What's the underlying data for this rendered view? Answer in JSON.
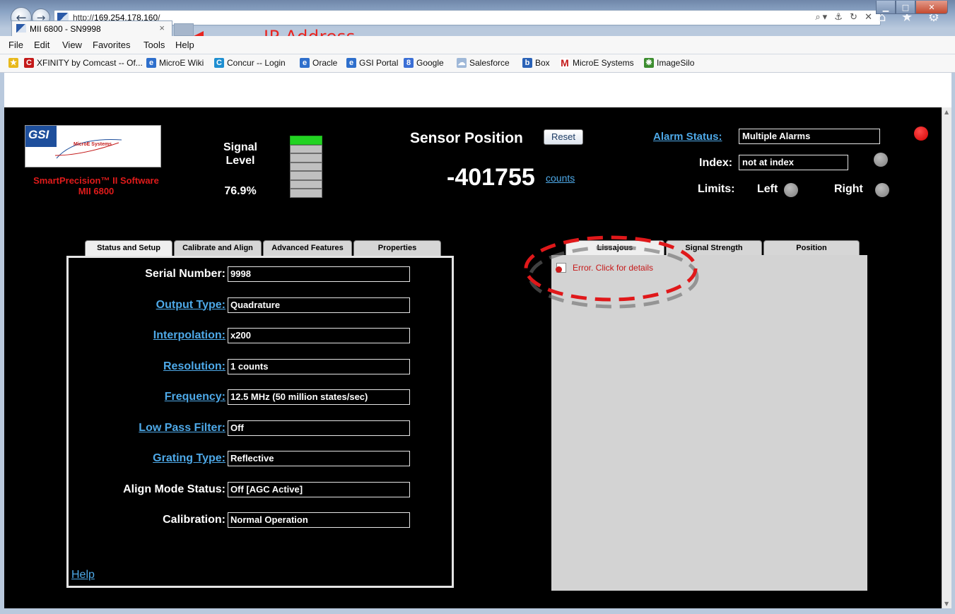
{
  "browser": {
    "url_scheme": "http://",
    "url_host": "169.254.178.160",
    "url_path": "/",
    "tab_title": "MII 6800 - SN9998",
    "tab_close": "×",
    "address_tools": "⌕▾ ⚓ ↻ ✕",
    "right_icons": "⌂ ★ ⚙",
    "menu": [
      "File",
      "Edit",
      "View",
      "Favorites",
      "Tools",
      "Help"
    ],
    "favorites": [
      {
        "label": "XFINITY by Comcast -- Of...",
        "icon": "C",
        "color": "#c41a1a"
      },
      {
        "label": "MicroE Wiki",
        "icon": "e",
        "color": "#2e6fcc"
      },
      {
        "label": "Concur -- Login",
        "icon": "C",
        "color": "#1f8fd1"
      },
      {
        "label": "Oracle",
        "icon": "e",
        "color": "#2e6fcc"
      },
      {
        "label": "GSI Portal",
        "icon": "e",
        "color": "#2e6fcc"
      },
      {
        "label": "Google",
        "icon": "8",
        "color": "#3b6fd6"
      },
      {
        "label": "Salesforce",
        "icon": "☁",
        "color": "#9fb8d8"
      },
      {
        "label": "Box",
        "icon": "b",
        "color": "#2a62b7"
      },
      {
        "label": "MicroE Systems",
        "icon": "M",
        "color": "#c41a1a"
      },
      {
        "label": "ImageSilo",
        "icon": "❋",
        "color": "#3c8d2f"
      }
    ],
    "annotation_label": "IP Address"
  },
  "app": {
    "logo_text": "GSI",
    "logo_microe": "MicroE Systems",
    "product_line1": "SmartPrecision™ II Software",
    "product_line2": "MII 6800",
    "signal_label_line1": "Signal",
    "signal_label_line2": "Level",
    "signal_value": "76.9%",
    "signal_fraction": 0.769,
    "signal_bars_total": 7,
    "signal_bars_on": 1,
    "sensor_label": "Sensor Position",
    "reset_label": "Reset",
    "position_value": "-401755",
    "position_units": "counts",
    "alarm_label": "Alarm Status:",
    "alarm_value": "Multiple Alarms",
    "index_label": "Index:",
    "index_value": "not at index",
    "limits_label": "Limits:",
    "limits_left": "Left",
    "limits_right": "Right",
    "colors": {
      "alarm_led": "#e00000",
      "off_led": "#8c8c8c",
      "link": "#4ea9e8",
      "product": "#e01b1b",
      "signal_on": "#22d322"
    }
  },
  "left_tabs": [
    "Status and Setup",
    "Calibrate and Align",
    "Advanced Features",
    "Properties"
  ],
  "right_tabs": [
    "Lissajous",
    "Signal Strength",
    "Position"
  ],
  "setup_rows": [
    {
      "label": "Serial Number:",
      "value": "9998",
      "link": false
    },
    {
      "label": "Output Type:",
      "value": "Quadrature",
      "link": true
    },
    {
      "label": "Interpolation:",
      "value": "x200",
      "link": true
    },
    {
      "label": "Resolution:",
      "value": "1 counts",
      "link": true
    },
    {
      "label": "Frequency:",
      "value": "12.5 MHz (50 million states/sec)",
      "link": true
    },
    {
      "label": "Low Pass Filter:",
      "value": "Off",
      "link": true
    },
    {
      "label": "Grating Type:",
      "value": "Reflective",
      "link": true
    },
    {
      "label": "Align Mode Status:",
      "value": "Off [AGC Active]",
      "link": false
    },
    {
      "label": "Calibration:",
      "value": "Normal Operation",
      "link": false
    }
  ],
  "help_label": "Help",
  "error_text": "Error. Click for details"
}
